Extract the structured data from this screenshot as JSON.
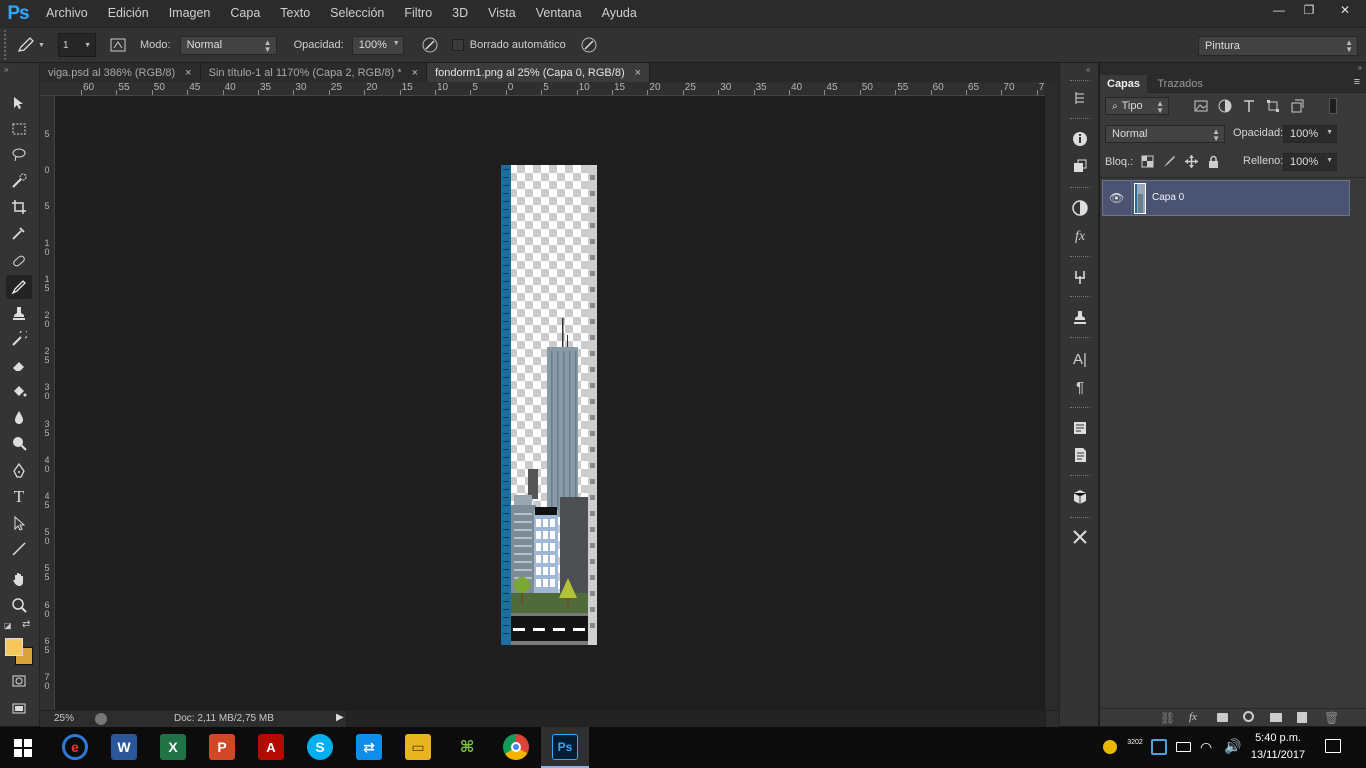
{
  "app": {
    "logo": "Ps"
  },
  "menu": [
    "Archivo",
    "Edición",
    "Imagen",
    "Capa",
    "Texto",
    "Selección",
    "Filtro",
    "3D",
    "Vista",
    "Ventana",
    "Ayuda"
  ],
  "window_controls": {
    "minimize": "—",
    "restore": "❐",
    "close": "✕"
  },
  "options": {
    "brush_size": "1",
    "mode_label": "Modo:",
    "mode_value": "Normal",
    "opacity_label": "Opacidad:",
    "opacity_value": "100%",
    "auto_erase_label": "Borrado automático",
    "workspace": "Pintura"
  },
  "doc_tabs": [
    {
      "label": "viga.psd al 386% (RGB/8)",
      "close": "×"
    },
    {
      "label": "Sin título-1 al 1170% (Capa 2, RGB/8) *",
      "close": "×"
    },
    {
      "label": "fondorm1.png al 25% (Capa 0, RGB/8)",
      "close": "×"
    }
  ],
  "ruler_h": [
    "60",
    "55",
    "50",
    "45",
    "40",
    "35",
    "30",
    "25",
    "20",
    "15",
    "10",
    "5",
    "0",
    "5",
    "10",
    "15",
    "20",
    "25",
    "30",
    "35",
    "40",
    "45",
    "50",
    "55",
    "60",
    "65",
    "70",
    "7"
  ],
  "ruler_v": [
    "5",
    "0",
    "5",
    "1\n0",
    "1\n5",
    "2\n0",
    "2\n5",
    "3\n0",
    "3\n5",
    "4\n0",
    "4\n5",
    "5\n0",
    "5\n5",
    "6\n0",
    "6\n5",
    "7\n0",
    "7"
  ],
  "status": {
    "zoom": "25%",
    "doc": "Doc: 2,11 MB/2,75 MB"
  },
  "layers_panel": {
    "tabs": [
      "Capas",
      "Trazados"
    ],
    "filter": "Tipo",
    "blend_mode": "Normal",
    "opacity_label": "Opacidad:",
    "opacity_value": "100%",
    "lock_label": "Bloq.:",
    "fill_label": "Relleno:",
    "fill_value": "100%",
    "layers": [
      {
        "name": "Capa 0"
      }
    ]
  },
  "colors": {
    "foreground": "#f6c75a",
    "background": "#d9a43b",
    "accent": "#31a8ff",
    "layer_selected": "#4b5372"
  },
  "taskbar": {
    "clock_time": "5:40 p.m.",
    "clock_date": "13/11/2017",
    "tray_temp": "3202"
  }
}
